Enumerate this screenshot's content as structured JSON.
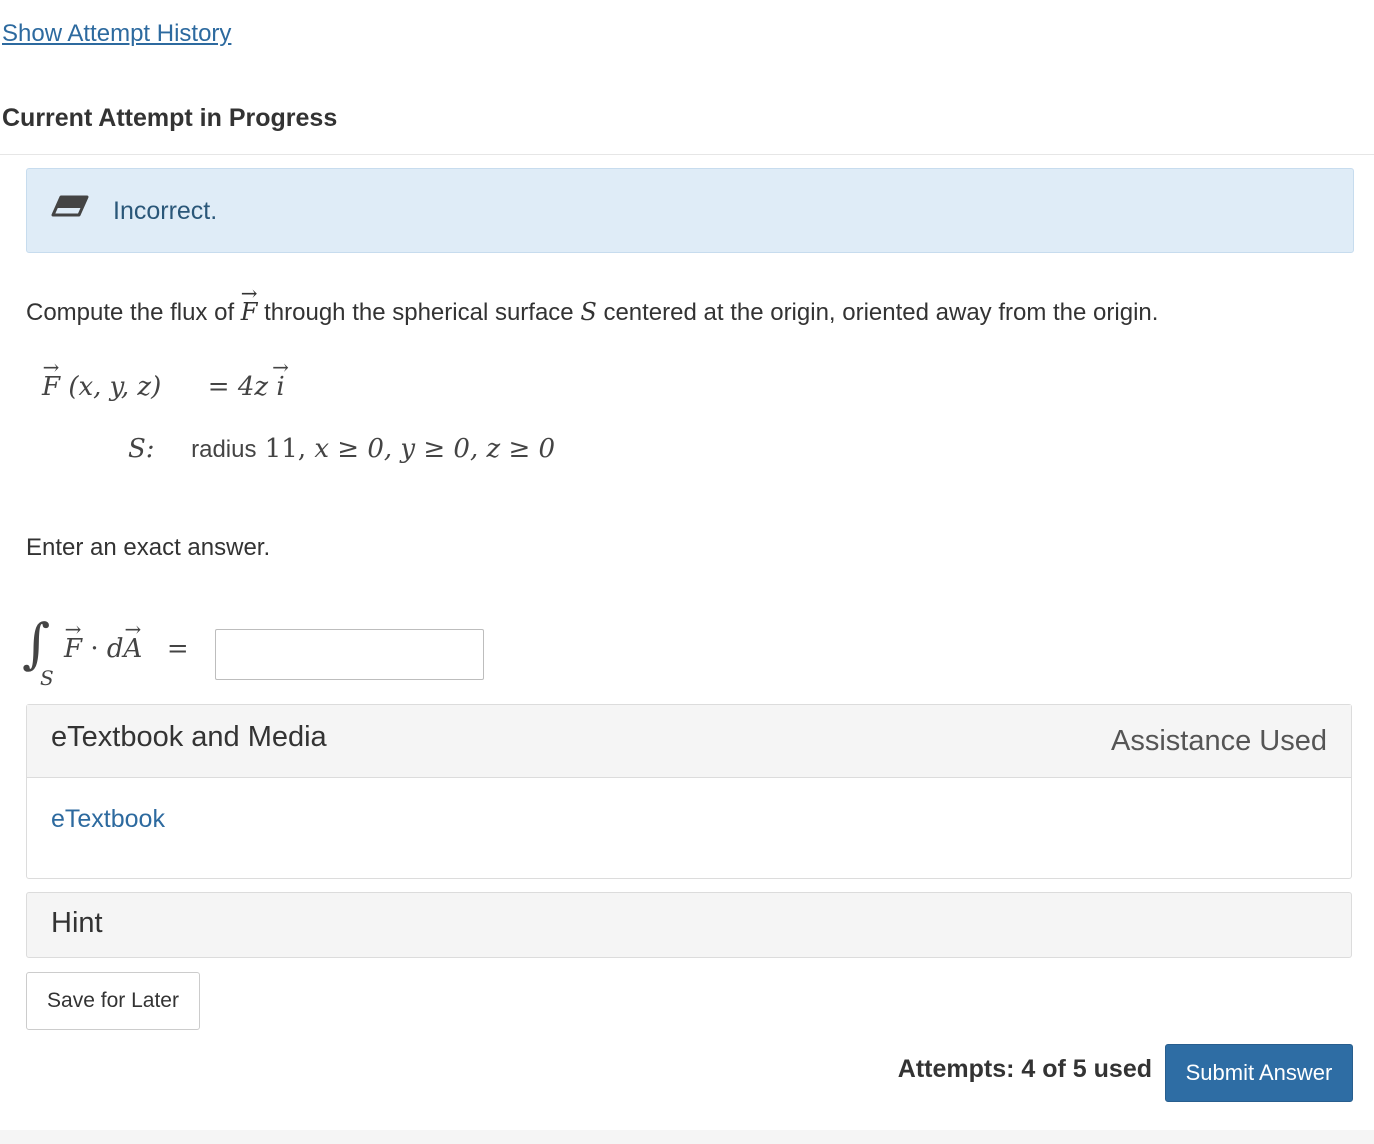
{
  "history": {
    "link_label": "Show Attempt History"
  },
  "attempt": {
    "heading": "Current Attempt in Progress"
  },
  "feedback": {
    "icon": "eraser-icon",
    "message": "Incorrect."
  },
  "question": {
    "prefix": "Compute the flux of",
    "vec_symbol": "F",
    "middle": "through the spherical surface",
    "surface_symbol": "S",
    "suffix": "centered at the origin, oriented away from the origin."
  },
  "field": {
    "lhs_symbol": "F",
    "lhs_args": "(x, y, z)",
    "equals": "=",
    "rhs_coeff": "4z",
    "rhs_unit": "i"
  },
  "surface": {
    "label": "S:",
    "radius_text": "radius",
    "radius_value": "11,",
    "conditions": "x ≥ 0, y ≥ 0, z ≥ 0"
  },
  "instruction": "Enter an exact answer.",
  "integral": {
    "symbol": "∫",
    "subscript": "S",
    "f_symbol": "F",
    "dot": "·",
    "d": "d",
    "a_symbol": "A",
    "equals": "=",
    "answer_value": "",
    "answer_placeholder": ""
  },
  "media_panel": {
    "title": "eTextbook and Media",
    "assistance_label": "Assistance Used",
    "etextbook_link": "eTextbook"
  },
  "hint_panel": {
    "title": "Hint"
  },
  "actions": {
    "save_label": "Save for Later",
    "attempts_text": "Attempts: 4 of 5 used",
    "submit_label": "Submit Answer"
  },
  "colors": {
    "link": "#2d6a9f",
    "feedback_bg": "#dfecf7",
    "feedback_text": "#2a5779",
    "primary_button": "#2e6da4"
  }
}
